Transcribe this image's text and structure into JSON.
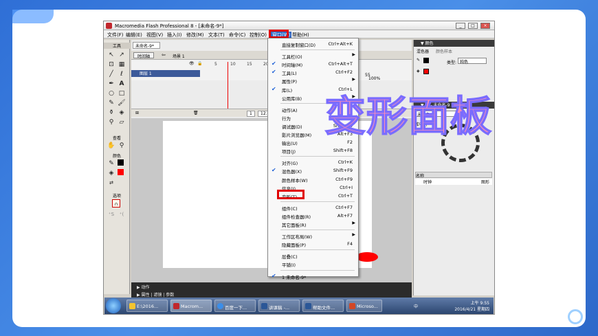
{
  "window": {
    "title": "Macromedia Flash Professional 8 - [未命名-9*]",
    "controls": [
      "_",
      "□",
      "×"
    ]
  },
  "menubar": [
    "文件(F)",
    "编辑(E)",
    "视图(V)",
    "插入(I)",
    "修改(M)",
    "文本(T)",
    "命令(C)",
    "控制(O)",
    "窗口(W)",
    "帮助(H)"
  ],
  "toolbox": {
    "header": "工具",
    "view_label": "查看",
    "colors_label": "颜色",
    "options_label": "选项"
  },
  "document": {
    "tab": "未命名-9*",
    "timeline_button": "时间轴",
    "scene": "场景 1",
    "zoom": "100%",
    "layer_name": "图层 1",
    "frame_numbers_left": [
      "5",
      "10",
      "15",
      "20"
    ],
    "frame_numbers_right": [
      "55",
      "60",
      "65"
    ],
    "frame_current": "1",
    "fps": "12.0 f"
  },
  "properties": {
    "actions": "▶ 动作",
    "tabs": "▶ 属性 | 滤镜 | 参数"
  },
  "window_menu": {
    "items": [
      {
        "label": "直接复制窗口(D)",
        "shortcut": "Ctrl+Alt+K",
        "checked": false,
        "submenu": false
      },
      {
        "sep": true
      },
      {
        "label": "工具栏(O)",
        "shortcut": "",
        "checked": false,
        "submenu": true
      },
      {
        "label": "时间轴(M)",
        "shortcut": "Ctrl+Alt+T",
        "checked": true,
        "submenu": false
      },
      {
        "label": "工具(L)",
        "shortcut": "Ctrl+F2",
        "checked": true,
        "submenu": false
      },
      {
        "label": "属性(P)",
        "shortcut": "",
        "checked": false,
        "submenu": true
      },
      {
        "label": "库(L)",
        "shortcut": "Ctrl+L",
        "checked": true,
        "submenu": false
      },
      {
        "label": "公用库(B)",
        "shortcut": "",
        "checked": false,
        "submenu": true
      },
      {
        "sep": true
      },
      {
        "label": "动作(A)",
        "shortcut": "F9",
        "checked": false,
        "submenu": false
      },
      {
        "label": "行为",
        "shortcut": "Shift+F3",
        "checked": false,
        "submenu": false
      },
      {
        "label": "调试器(D)",
        "shortcut": "Shift+F4",
        "checked": false,
        "submenu": false
      },
      {
        "label": "影片浏览器(M)",
        "shortcut": "Alt+F3",
        "checked": false,
        "submenu": false
      },
      {
        "label": "输出(U)",
        "shortcut": "F2",
        "checked": false,
        "submenu": false
      },
      {
        "label": "项目(J)",
        "shortcut": "Shift+F8",
        "checked": false,
        "submenu": false
      },
      {
        "sep": true
      },
      {
        "label": "对齐(G)",
        "shortcut": "Ctrl+K",
        "checked": false,
        "submenu": false
      },
      {
        "label": "混色器(X)",
        "shortcut": "Shift+F9",
        "checked": true,
        "submenu": false
      },
      {
        "label": "颜色样本(W)",
        "shortcut": "Ctrl+F9",
        "checked": false,
        "submenu": false
      },
      {
        "label": "信息(I)",
        "shortcut": "Ctrl+I",
        "checked": false,
        "submenu": false
      },
      {
        "label": "变形(T)",
        "shortcut": "Ctrl+T",
        "checked": false,
        "submenu": false
      },
      {
        "sep": true
      },
      {
        "label": "组件(C)",
        "shortcut": "Ctrl+F7",
        "checked": false,
        "submenu": false
      },
      {
        "label": "组件检查器(R)",
        "shortcut": "Alt+F7",
        "checked": false,
        "submenu": false
      },
      {
        "label": "其它面板(R)",
        "shortcut": "",
        "checked": false,
        "submenu": true
      },
      {
        "sep": true
      },
      {
        "label": "工作区布局(W)",
        "shortcut": "",
        "checked": false,
        "submenu": true
      },
      {
        "label": "隐藏面板(P)",
        "shortcut": "F4",
        "checked": false,
        "submenu": false
      },
      {
        "sep": true
      },
      {
        "label": "层叠(C)",
        "shortcut": "",
        "checked": false,
        "submenu": false
      },
      {
        "label": "平铺(I)",
        "shortcut": "",
        "checked": false,
        "submenu": false
      },
      {
        "sep": true
      },
      {
        "label": "1 未命名-9*",
        "shortcut": "",
        "checked": true,
        "submenu": false
      }
    ]
  },
  "right_panel": {
    "color_header": "▼ 颜色",
    "mixer_tab": "混色器",
    "swatches_tab": "颜色样本",
    "type_label": "类型:",
    "type_value": "纯色",
    "library_header": "▼ 库 - 未命名-9",
    "library_select": "未命名-9",
    "library_count_prefix": "库中有",
    "col_name": "名称",
    "row_name": "时钟",
    "row_type": "图形"
  },
  "overlay_label": "变形面板",
  "taskbar": {
    "items": [
      "E:\\2016...",
      "Macrom...",
      "百度一下...",
      "讲课稿 -...",
      "帮助文件...",
      "Microso..."
    ],
    "tray_lang": "中",
    "time": "上午 9:55",
    "date": "2016/4/21 星期四"
  },
  "colors": {
    "highlight": "#e00000",
    "overlay_fill": "#ff8fb5",
    "overlay_stroke": "#7a6cff",
    "stage_shape": "#ff0000"
  }
}
